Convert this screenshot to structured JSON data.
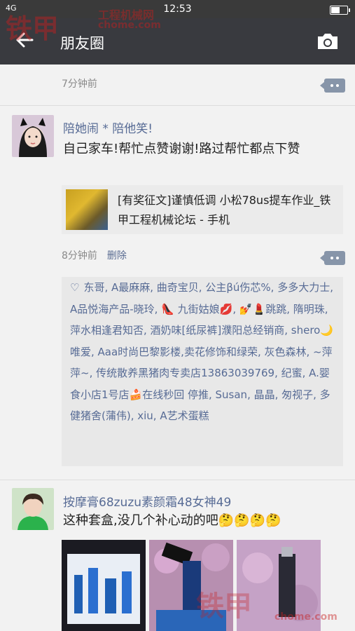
{
  "status": {
    "signal": "4G",
    "time": "12:53",
    "battery_level": 0.62
  },
  "header": {
    "back_icon": "arrow-left-icon",
    "title": "朋友圈",
    "camera_icon": "camera-icon"
  },
  "watermark": {
    "logo": "铁甲",
    "site": "工程机械网",
    "url": "chome.com"
  },
  "posts": [
    {
      "time_ago": "7分钟前"
    },
    {
      "nickname": "陪她闹 * 陪他笑!",
      "text": "自己家车!帮忙点赞谢谢!路过帮忙都点下赞",
      "share_title": "[有奖征文]谨慎低调 小松78us提车作业_铁甲工程机械论坛 - 手机",
      "time_ago": "8分钟前",
      "delete_label": "删除",
      "likes": "东哥, A最麻麻, 曲奇宝贝, 公主βú伤芯%, 多多大力士, A品悦海产品-晓玲, 👠 九街姑娘💋, 💅💄跳跳, 隋明珠, 萍水相逢君知否, 酒奶味[纸尿裤]濮阳总经销商, shero🌙唯爱, Aaa时尚巴黎影楼,卖花修饰和绿荣, 灰色森林, ~萍萍~, 传统散养黑猪肉专卖店13863039769, 纪蜜, A.婴食小店1号店🍰在线秒回 停推, Susan, 晶晶, 匆视子, 多健猪舍(蒲伟), xiu, A艺术蛋糕"
    },
    {
      "nickname": "按摩膏68zuzu素颜霜48女神49",
      "text": "这种套盒,没几个补心动的吧🤔🤔🤔🤔"
    }
  ]
}
